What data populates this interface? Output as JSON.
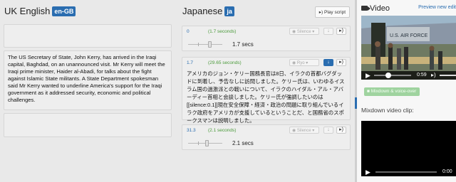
{
  "left": {
    "language": "UK English",
    "code": "en-GB",
    "paragraph": "The US Secretary of State, John Kerry, has arrived in the Iraqi capital, Baghdad, on an unannounced visit. Mr Kerry will meet the Iraqi prime minister, Haider al-Abadi, for talks about the fight against Islamic State militants. A State Department spokesman said Mr Kerry wanted to underline America's support for the Iraqi government as it addressed security, economic and political challenges."
  },
  "middle": {
    "language": "Japanese",
    "code": "ja",
    "play_script": "Play script",
    "segments": [
      {
        "index": "0",
        "duration": "(1.7 seconds)",
        "voice": "Silence",
        "length": "1.7 secs",
        "active": false
      },
      {
        "index": "1.7",
        "duration": "(29.65 seconds)",
        "voice": "Ryo",
        "text": "アメリカのジョン・ケリー国務長官は8日、イラクの首都バグダッドに到着し、予告なしに訪問しました。ケリー氏は、いわゆるイスラム国の過激派との戦いについて、イラクのハイダル・アル・アバーディー首相と会談しました。ケリー氏が強調したいのは[[silence:0.1]]現在安全保障・経済・政治の問題に取り組んでいるイラク政府をアメリカが支援しているということだ、と国務省のスポークスマンは説明しました。",
        "active": true
      },
      {
        "index": "31.3",
        "duration": "(2.1 seconds)",
        "voice": "Silence",
        "length": "2.1 secs",
        "active": false
      }
    ]
  },
  "right": {
    "title": "Video",
    "preview_link": "Preview new edit",
    "player_time": "0:59",
    "mixdown_button": "Mixdown & voice-over",
    "mixdown_label": "Mixdown video clip:",
    "mix_time": "0:00"
  },
  "colors": {
    "accent": "#2a6db0",
    "duration_green": "#4a9a3a",
    "mixdown_green": "#9fd39f"
  }
}
